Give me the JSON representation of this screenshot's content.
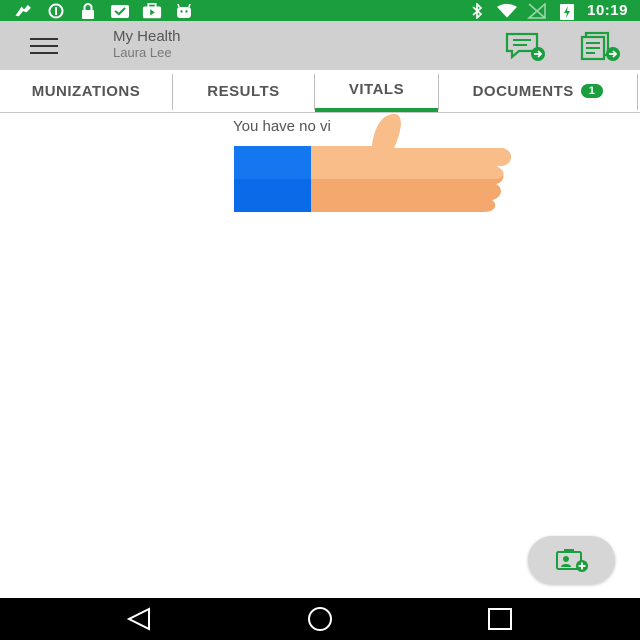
{
  "status_bar": {
    "time": "10:19",
    "left_icons": [
      "fab-mode-icon",
      "info-circle-icon",
      "lock-icon",
      "mail-check-icon",
      "briefcase-play-icon",
      "android-icon"
    ],
    "right_icons": [
      "bluetooth-icon",
      "wifi-icon",
      "no-sim-icon",
      "battery-charging-icon"
    ]
  },
  "app_bar": {
    "title": "My Health",
    "subtitle": "Laura Lee",
    "menu_icon": "hamburger-menu-icon",
    "action_icons": [
      "send-message-icon",
      "send-document-icon"
    ]
  },
  "tabs": [
    {
      "label": "MUNIZATIONS",
      "active": false
    },
    {
      "label": "RESULTS",
      "active": false
    },
    {
      "label": "VITALS",
      "active": true
    },
    {
      "label": "DOCUMENTS",
      "active": false,
      "badge": "1"
    }
  ],
  "content": {
    "empty_message": "You have no vi",
    "overlay": "thumbs-up-icon"
  },
  "fab": {
    "icon": "add-profile-card-icon"
  },
  "nav_bar": {
    "icons": [
      "back-icon",
      "home-icon",
      "recents-icon"
    ]
  },
  "colors": {
    "accent": "#1b9e3e",
    "app_bar": "#d0d0d0",
    "thumb_skin": "#f4b47a",
    "cuff": "#0a6be8"
  }
}
